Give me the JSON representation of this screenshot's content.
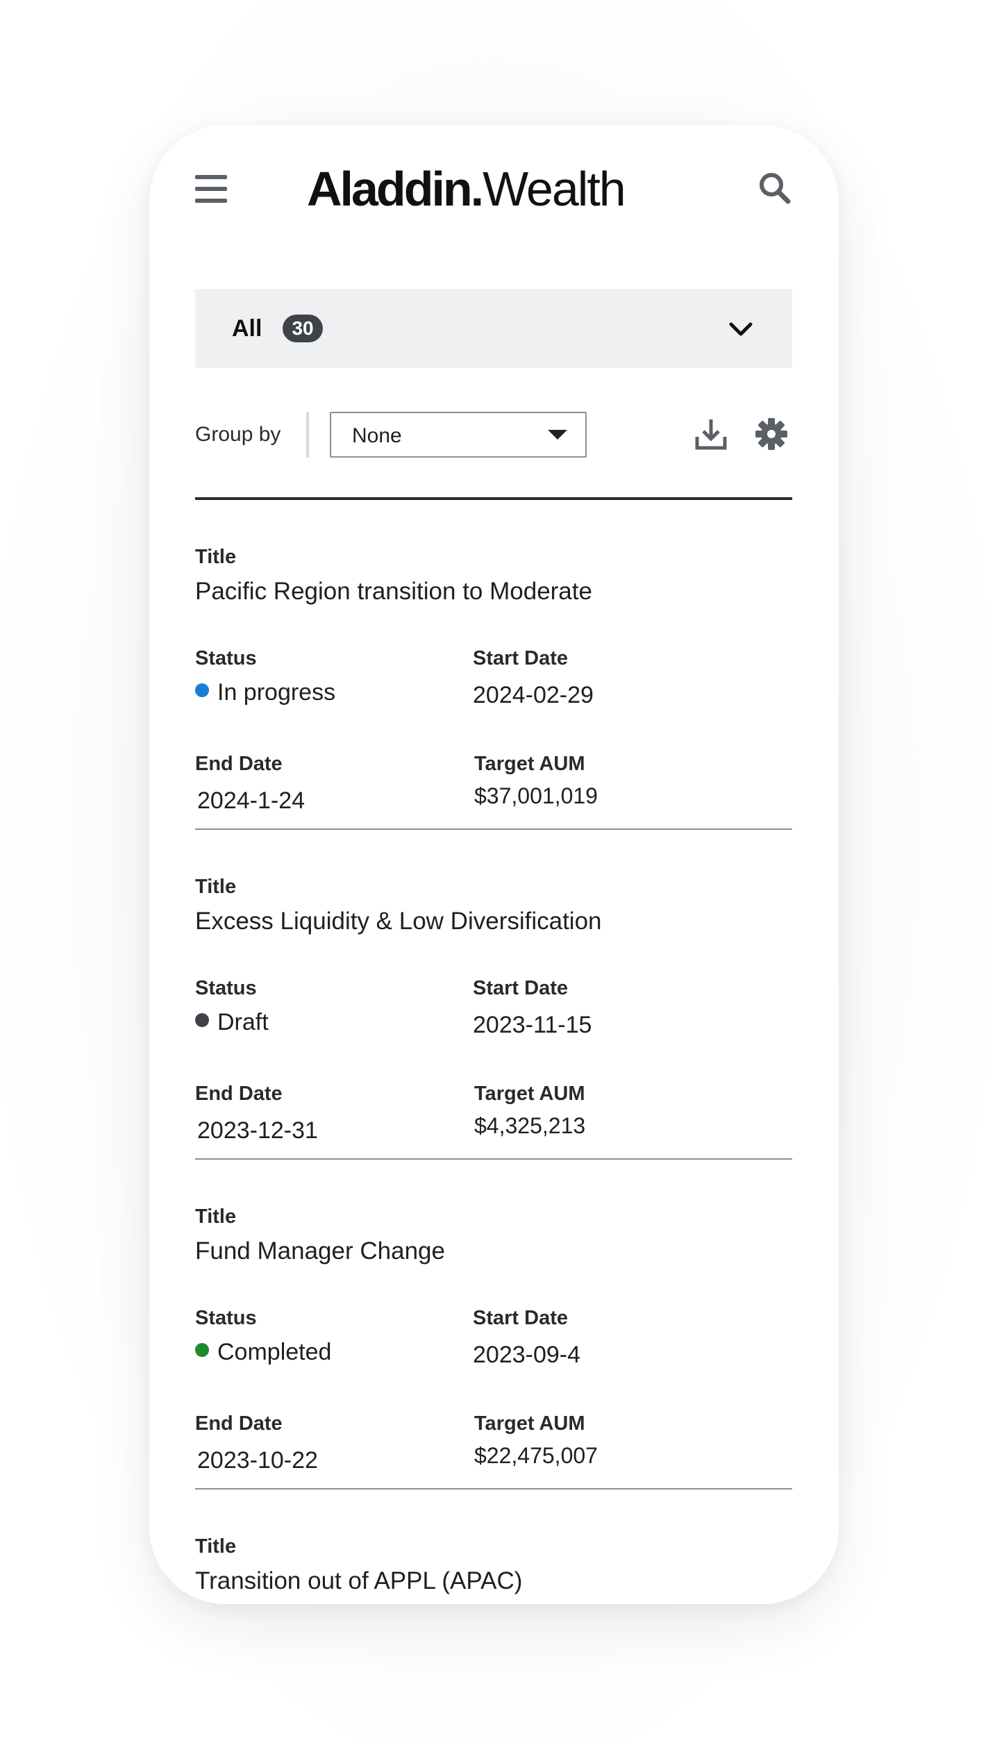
{
  "header": {
    "logo_bold": "Aladdin",
    "logo_regular": "Wealth",
    "menu_icon": "hamburger-menu-icon",
    "search_icon": "search-icon"
  },
  "filter": {
    "label": "All",
    "count": "30",
    "chevron_icon": "chevron-down-icon"
  },
  "toolbar": {
    "group_by_label": "Group by",
    "group_by_value": "None",
    "download_icon": "download-icon",
    "settings_icon": "gear-icon"
  },
  "labels": {
    "title": "Title",
    "status": "Status",
    "start_date": "Start Date",
    "end_date": "End Date",
    "target_aum": "Target AUM"
  },
  "colors": {
    "in_progress": "#1a7fd4",
    "draft": "#3f4349",
    "completed": "#1e8a2a"
  },
  "items": [
    {
      "title": "Pacific Region transition to Moderate",
      "status": "In progress",
      "status_color": "#1a7fd4",
      "start_date": "2024-02-29",
      "end_date": "2024-1-24",
      "target_aum": "$37,001,019"
    },
    {
      "title": "Excess Liquidity & Low Diversification",
      "status": "Draft",
      "status_color": "#3f4349",
      "start_date": "2023-11-15",
      "end_date": "2023-12-31",
      "target_aum": "$4,325,213"
    },
    {
      "title": "Fund Manager Change",
      "status": "Completed",
      "status_color": "#1e8a2a",
      "start_date": "2023-09-4",
      "end_date": "2023-10-22",
      "target_aum": "$22,475,007"
    },
    {
      "title": "Transition out of APPL (APAC)"
    }
  ]
}
